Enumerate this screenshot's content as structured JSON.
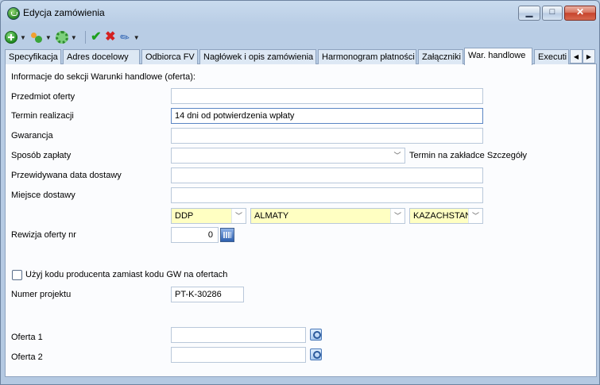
{
  "window": {
    "title": "Edycja zamówienia"
  },
  "toolbar": {
    "icons": [
      "add-icon",
      "contacts-icon",
      "gear-icon",
      "accept-icon",
      "cancel-icon",
      "attachment-icon"
    ]
  },
  "tabs": [
    "Specyfikacja",
    "Adres docelowy",
    "Odbiorca FV",
    "Nagłówek i opis zamówienia",
    "Harmonogram płatności",
    "Załączniki",
    "War. handlowe",
    "Executi"
  ],
  "form": {
    "section_title": "Informacje do sekcji Warunki handlowe (oferta):",
    "subject_label": "Przedmiot oferty",
    "subject_value": "",
    "lead_time_label": "Termin realizacji",
    "lead_time_value": "14 dni od potwierdzenia wpłaty",
    "warranty_label": "Gwarancja",
    "warranty_value": "",
    "payment_label": "Sposób zapłaty",
    "payment_value": "",
    "payment_note": "Termin na zakładce Szczegóły",
    "delivery_date_label": "Przewidywana data dostawy",
    "delivery_date_value": "",
    "delivery_place_label": "Miejsce dostawy",
    "delivery_place_value": "",
    "incoterm_value": "DDP",
    "city_value": "ALMATY",
    "country_value": "KAZACHSTAN",
    "revision_label": "Rewizja oferty nr",
    "revision_value": "0",
    "producer_code_label": "Użyj kodu producenta zamiast kodu GW na ofertach",
    "producer_code_checked": false,
    "project_label": "Numer projektu",
    "project_value": "PT-K-30286",
    "offer1_label": "Oferta 1",
    "offer1_value": "",
    "offer2_label": "Oferta 2",
    "offer2_value": ""
  }
}
